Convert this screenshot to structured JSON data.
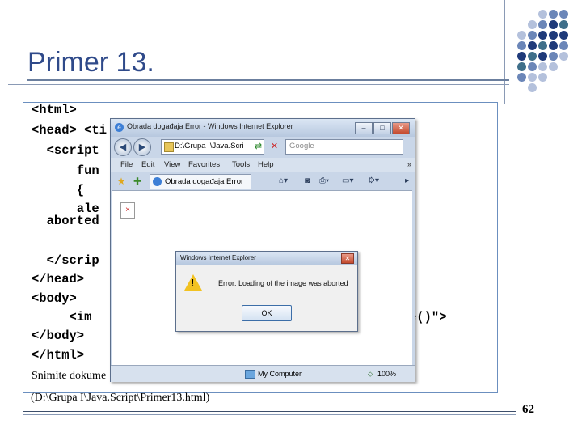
{
  "slide": {
    "title": "Primer 13.",
    "page_number": "62",
    "code_lines": [
      "<html>",
      "<head> <ti",
      "  <script",
      "      fun",
      "      {",
      "      ale",
      "  aborted",
      "",
      "  </scrip",
      "</head>",
      "<body>",
      "     <im",
      "</body>",
      "</html>"
    ],
    "code_tail": "e()\">",
    "save_line_1": "Snimite dokume",
    "save_line_2": "(D:\\Grupa I\\Java.Script\\Primer13.html)"
  },
  "ie_window": {
    "title": "Obrada događaja Error - Windows Internet Explorer",
    "minimize": "–",
    "maximize": "□",
    "close": "✕",
    "address": "D:\\Grupa I\\Java.Scri",
    "search_placeholder": "Google",
    "menu": [
      "File",
      "Edit",
      "View",
      "Favorites",
      "Tools",
      "Help"
    ],
    "menu_overflow": "»",
    "tab_title": "Obrada događaja Error",
    "status_zone": "My Computer",
    "zoom": "100%"
  },
  "alert_dialog": {
    "title": "Windows Internet Explorer",
    "message": "Error: Loading of the image was aborted",
    "ok_label": "OK",
    "close": "✕"
  },
  "colors": {
    "title": "#2f4a8a",
    "dot_dark": "#1f3a7a",
    "dot_mid": "#6b86b8",
    "dot_light": "#b4c1dc",
    "dot_teal": "#3f6f8a"
  }
}
